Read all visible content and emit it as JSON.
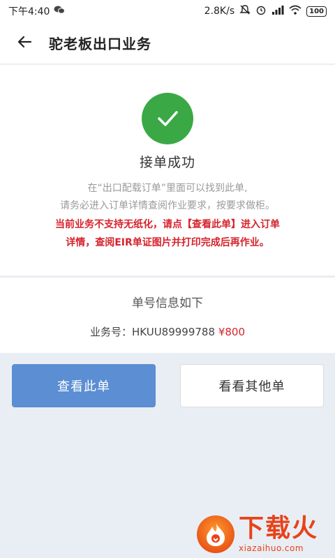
{
  "status_bar": {
    "time": "下午4:40",
    "speed": "2.8K/s",
    "battery": "100",
    "icons": [
      "wechat-icon",
      "mute-icon",
      "alarm-icon",
      "signal-icon",
      "wifi-icon",
      "battery-icon"
    ]
  },
  "header": {
    "title": "驼老板出口业务",
    "back_icon": "back-arrow-icon"
  },
  "success": {
    "icon": "check-icon",
    "title": "接单成功",
    "hint_lines": [
      "在“出口配载订单”里面可以找到此单,",
      "请务必进入订单详情查阅作业要求，按要求做柜。"
    ],
    "warning_lines": [
      "当前业务不支持无纸化，请点【查看此单】进入订单",
      "详情，查阅EIR单证图片并打印完成后再作业。"
    ]
  },
  "order_info": {
    "heading": "单号信息如下",
    "label": "业务号：HKUU89999788",
    "price": "¥800"
  },
  "buttons": {
    "view": "查看此单",
    "others": "看看其他单"
  },
  "watermark": {
    "cn": "下载火",
    "en": "xiazaihuo.com"
  },
  "colors": {
    "accent_green": "#3ba846",
    "warning_red": "#d6232c",
    "primary_blue": "#5b8ed3",
    "watermark_orange": "#e8421a"
  }
}
